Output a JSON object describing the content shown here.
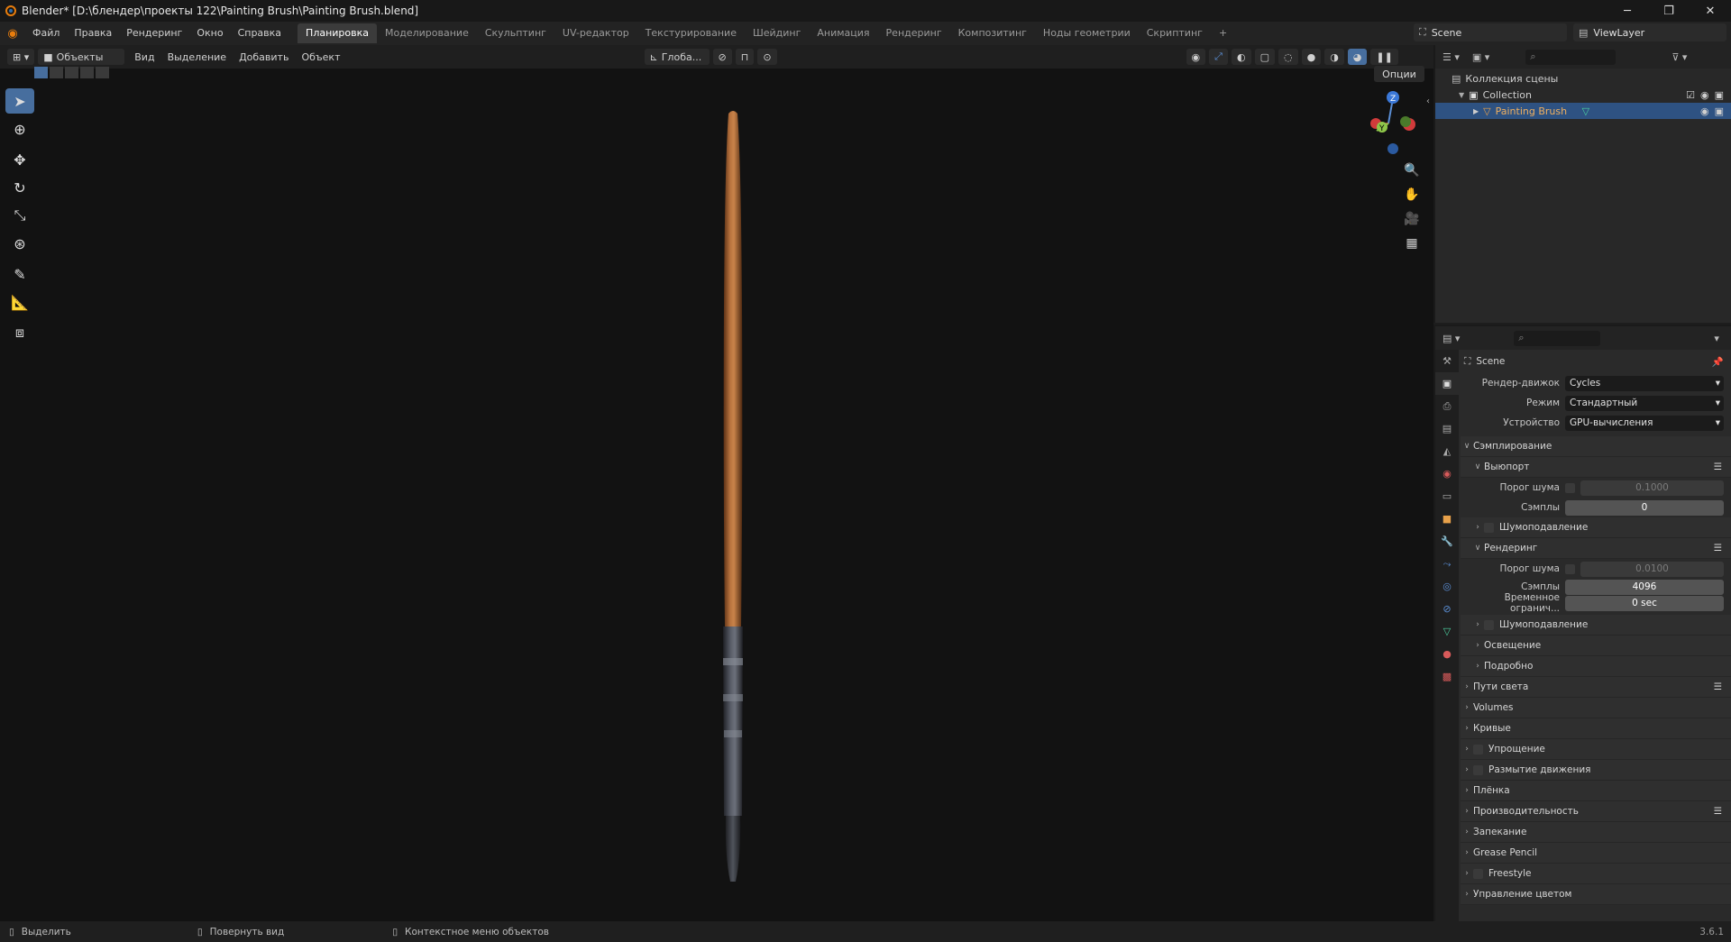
{
  "window": {
    "title": "Blender* [D:\\блендер\\проекты 122\\Painting Brush\\Painting Brush.blend]",
    "minimize": "─",
    "maximize": "❐",
    "close": "✕"
  },
  "menu": [
    "Файл",
    "Правка",
    "Рендеринг",
    "Окно",
    "Справка"
  ],
  "workspaces": [
    "Планировка",
    "Моделирование",
    "Скульптинг",
    "UV-редактор",
    "Текстурирование",
    "Шейдинг",
    "Анимация",
    "Рендеринг",
    "Композитинг",
    "Ноды геометрии",
    "Скриптинг",
    "+"
  ],
  "active_workspace": 0,
  "scene_name": "Scene",
  "view_layer": "ViewLayer",
  "viewport_header": {
    "mode": "Объекты",
    "menus": [
      "Вид",
      "Выделение",
      "Добавить",
      "Объект"
    ],
    "orientation": "Глоба...",
    "options": "Опции"
  },
  "outliner": {
    "root": "Коллекция сцены",
    "collection": "Collection",
    "object": "Painting Brush"
  },
  "properties": {
    "context": "Scene",
    "render_engine_label": "Рендер-движок",
    "render_engine": "Cycles",
    "mode_label": "Режим",
    "mode": "Стандартный",
    "device_label": "Устройство",
    "device": "GPU-вычисления",
    "sampling": "Сэмплирование",
    "viewport": "Выюпорт",
    "noise_label": "Порог шума",
    "vp_noise": "0.1000",
    "samples_label": "Сэмплы",
    "vp_samples": "0",
    "denoise": "Шумоподавление",
    "render": "Рендеринг",
    "r_noise": "0.0100",
    "r_samples": "4096",
    "time_limit_label": "Временное огранич...",
    "time_limit": "0 sec",
    "denoise2": "Шумоподавление",
    "lighting": "Освещение",
    "advanced": "Подробно",
    "sections": [
      "Пути света",
      "Volumes",
      "Кривые",
      "Упрощение",
      "Размытие движения",
      "Плёнка",
      "Производительность",
      "Запекание",
      "Grease Pencil",
      "Freestyle",
      "Управление цветом"
    ]
  },
  "status": {
    "select": "Выделить",
    "rotate": "Повернуть вид",
    "context": "Контекстное меню объектов",
    "version": "3.6.1"
  }
}
